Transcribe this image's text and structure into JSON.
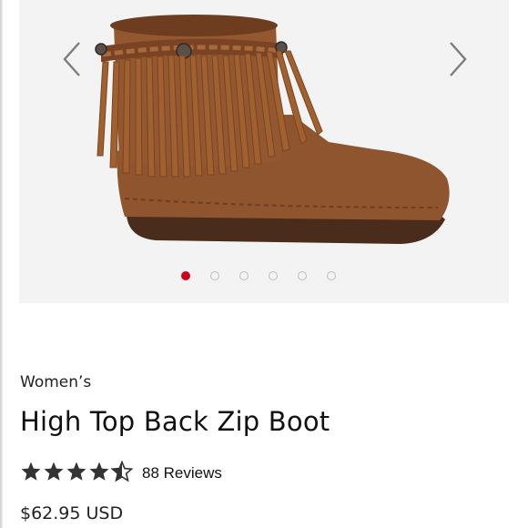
{
  "product": {
    "category": "Women’s",
    "title": "High Top Back Zip Boot",
    "rating": 4.5,
    "rating_max": 5,
    "reviews_label": "88 Reviews",
    "price": "$62.95 USD"
  },
  "gallery": {
    "image_count": 6,
    "active_index": 0,
    "prev_icon": "chevron-left-icon",
    "next_icon": "chevron-right-icon"
  },
  "colors": {
    "active_dot": "#d0021b",
    "suede": "#8a4f2a",
    "background": "#f3f3f3"
  }
}
